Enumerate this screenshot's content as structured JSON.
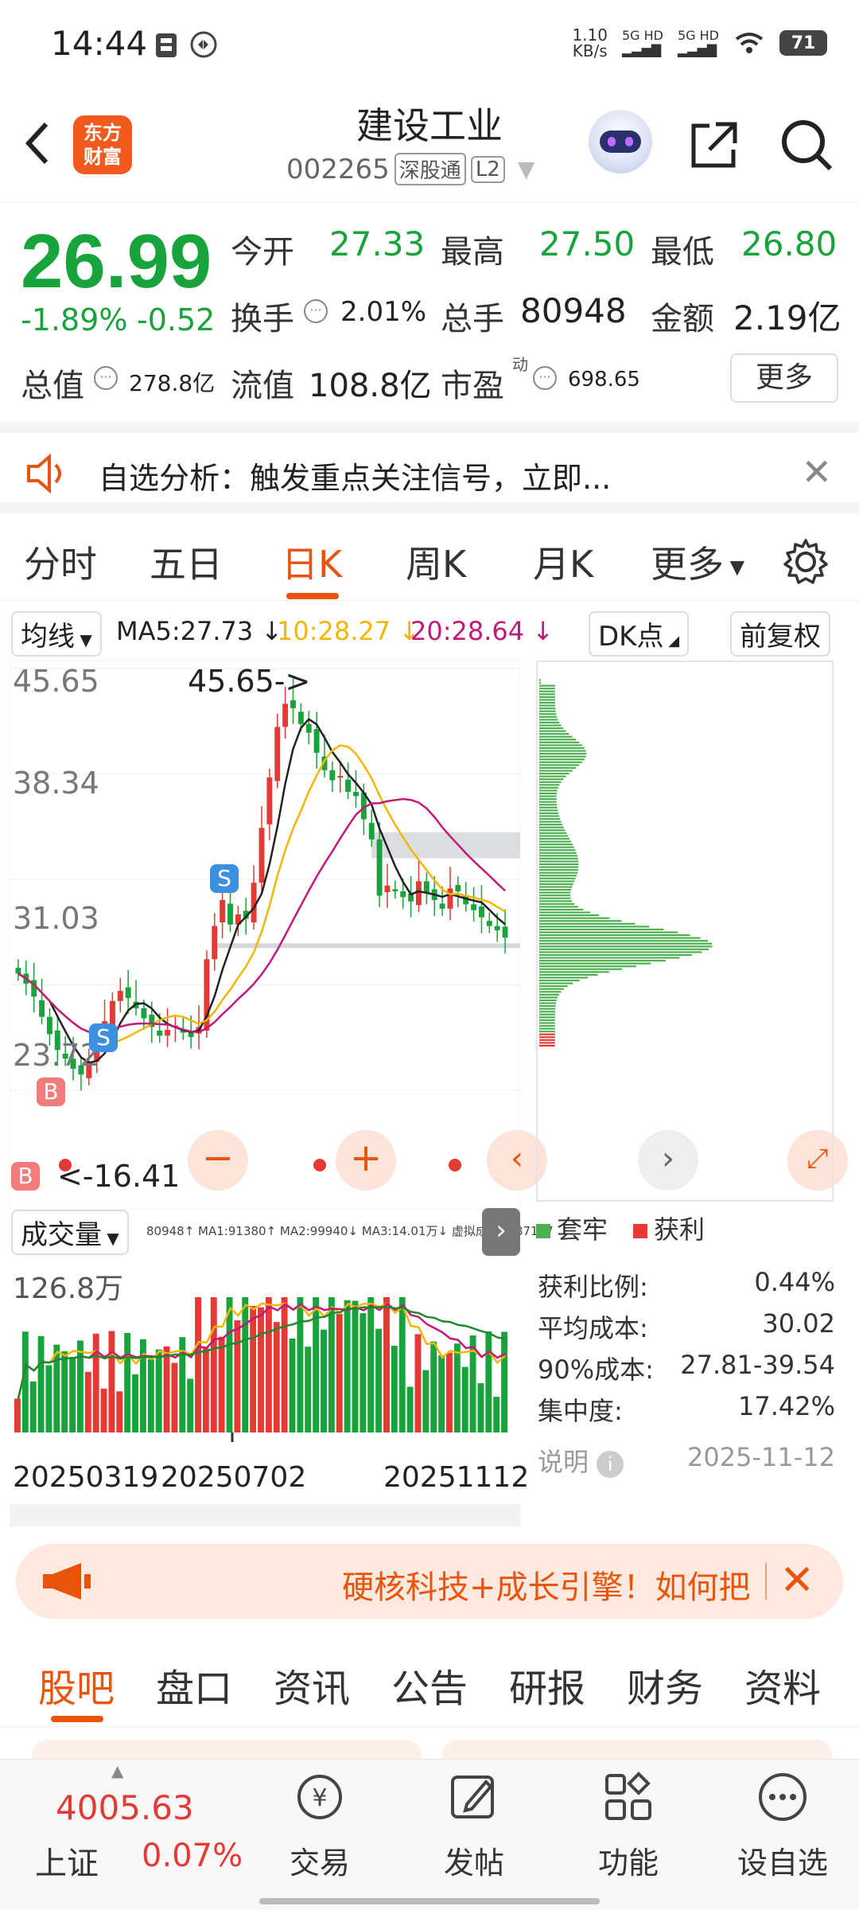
{
  "status": {
    "time": "14:44",
    "net_speed": "1.10\nKB/s",
    "net1": "5G HD",
    "net2": "5G HD",
    "battery": "71"
  },
  "header": {
    "logo": "东方财富",
    "title": "建设工业",
    "code": "002265",
    "tag1": "深股通",
    "tag2": "L2"
  },
  "quote": {
    "price": "26.99",
    "change_pct": "-1.89%",
    "change": "-0.52",
    "open_label": "今开",
    "open": "27.33",
    "high_label": "最高",
    "high": "27.50",
    "low_label": "最低",
    "low": "26.80",
    "turnover_label": "换手",
    "turnover": "2.01%",
    "volume_label": "总手",
    "volume": "80948",
    "amount_label": "金额",
    "amount": "2.19亿",
    "mktcap_label": "总值",
    "mktcap": "278.8亿",
    "float_label": "流值",
    "float": "108.8亿",
    "pe_label": "市盈",
    "pe_sup": "动",
    "pe": "698.65",
    "more": "更多"
  },
  "notice": {
    "text": "自选分析：触发重点关注信号，立即..."
  },
  "ktabs": [
    "分时",
    "五日",
    "日K",
    "周K",
    "月K",
    "更多"
  ],
  "indicator": {
    "ma_btn": "均线",
    "ma5": "MA5:27.73 ↓",
    "ma10": "10:28.27 ↓",
    "ma20": "20:28.64 ↓",
    "dk": "DK点",
    "fq": "前复权"
  },
  "colors": {
    "up": "#e53935",
    "down": "#18a33c",
    "accent": "#e8540c",
    "ma5": "#222222",
    "ma10": "#f2b705",
    "ma20": "#c2187a"
  },
  "chart": {
    "y_labels": [
      "45.65",
      "38.34",
      "31.03",
      "23.72",
      "16.41"
    ],
    "high_annot": "45.65->",
    "low_annot": "<-16.41",
    "signal_s": "S",
    "signal_b": "B"
  },
  "chart_data": {
    "type": "candlestick",
    "ylim": [
      16.41,
      45.65
    ],
    "y_ticks": [
      45.65,
      38.34,
      31.03,
      23.72,
      16.41
    ],
    "close_series": [
      24.5,
      23.8,
      22.9,
      21.5,
      20.3,
      19.2,
      18.6,
      17.9,
      17.5,
      18.4,
      19.8,
      21.2,
      22.6,
      23.3,
      22.8,
      22.1,
      21.4,
      20.8,
      20.2,
      20.6,
      20.9,
      20.4,
      20.1,
      20.8,
      25.5,
      27.8,
      29.6,
      27.9,
      28.6,
      28.3,
      30.8,
      34.6,
      38.1,
      41.6,
      43.2,
      42.9,
      41.8,
      41.2,
      39.8,
      38.6,
      37.9,
      38.2,
      37.1,
      36.8,
      35.2,
      33.8,
      29.9,
      30.6,
      30.2,
      29.8,
      29.5,
      30.9,
      30.1,
      29.6,
      29.0,
      30.4,
      30.2,
      29.3,
      28.9,
      28.4,
      27.8,
      27.5,
      26.99
    ],
    "distribution_legend": [
      "套牢",
      "获利"
    ],
    "stats": {
      "profit_ratio_label": "获利比例:",
      "profit_ratio": "0.44%",
      "avg_cost_label": "平均成本:",
      "avg_cost": "30.02",
      "cost90_label": "90%成本:",
      "cost90": "27.81-39.54",
      "concentration_label": "集中度:",
      "concentration": "17.42%",
      "note_label": "说明",
      "date": "2025-11-12"
    },
    "volume": {
      "label": "成交量",
      "values_text": "80948↑ MA1:91380↑ MA2:99940↓ MA3:14.01万↓ 虚拟成交量:87177",
      "max_label": "126.8万"
    },
    "x_ticks": [
      "20250319",
      "20250702",
      "20251112"
    ]
  },
  "banner": {
    "text": "硬核科技+成长引擎！如何把"
  },
  "btabs": [
    "股吧",
    "盘口",
    "资讯",
    "公告",
    "研报",
    "财务",
    "资料"
  ],
  "bnav": {
    "index_value": "4005.63",
    "index_name": "上证",
    "index_change": "0.07%",
    "items": [
      "交易",
      "发帖",
      "功能",
      "设自选"
    ]
  }
}
